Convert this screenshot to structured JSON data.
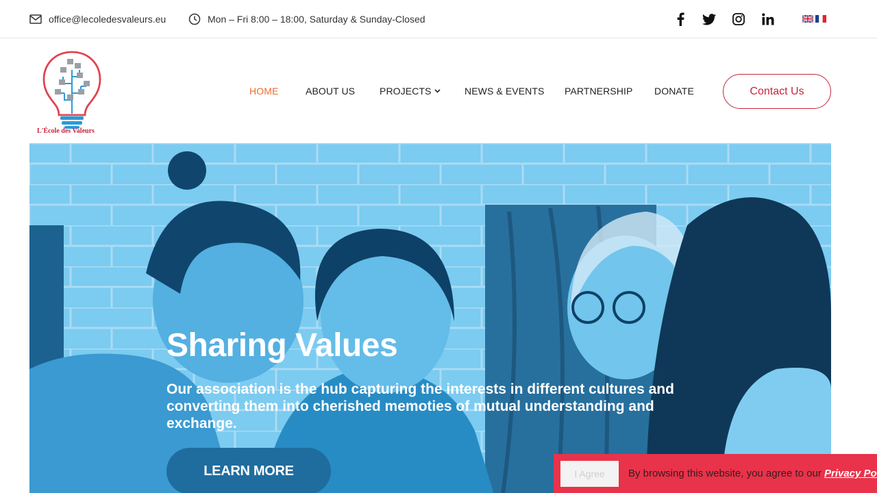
{
  "topbar": {
    "email": "office@lecoledesvaleurs.eu",
    "hours": "Mon – Fri 8:00 – 18:00, Saturday & Sunday-Closed",
    "social_icons": [
      "facebook-icon",
      "twitter-icon",
      "instagram-icon",
      "linkedin-icon"
    ],
    "languages": [
      "English",
      "Français"
    ]
  },
  "header": {
    "logo_text": "L'École des Valeurs",
    "nav": [
      {
        "label": "HOME",
        "active": true
      },
      {
        "label": "ABOUT US"
      },
      {
        "label": "PROJECTS",
        "has_dropdown": true
      },
      {
        "label": "NEWS & EVENTS"
      },
      {
        "label": "PARTNERSHIP"
      },
      {
        "label": "DONATE"
      }
    ],
    "contact_label": "Contact Us"
  },
  "hero": {
    "title": "Sharing Values",
    "text": "Our association is the hub capturing the interests in different cultures and converting them into cherished memoties of mutual understanding and exchange.",
    "button_label": "LEARN MORE"
  },
  "cookie": {
    "agree_label": "I Agree",
    "text": "By browsing this website, you agree to our ",
    "link_label": "Privacy Policy"
  },
  "colors": {
    "accent_orange": "#ef6c2a",
    "brand_red": "#c8243a",
    "hero_button": "#1f6d9e",
    "cookie_bg": "#e8334a"
  }
}
